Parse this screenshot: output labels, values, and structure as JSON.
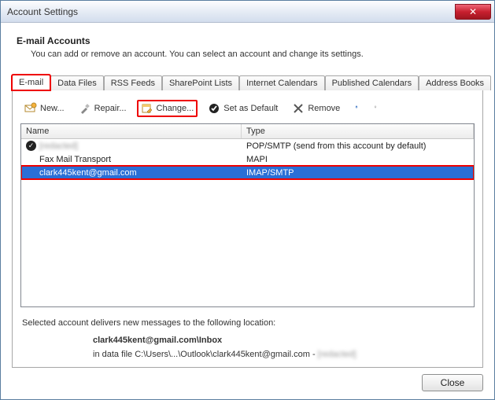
{
  "window": {
    "title": "Account Settings"
  },
  "header": {
    "title": "E-mail Accounts",
    "desc": "You can add or remove an account. You can select an account and change its settings."
  },
  "tabs": {
    "items": [
      {
        "label": "E-mail"
      },
      {
        "label": "Data Files"
      },
      {
        "label": "RSS Feeds"
      },
      {
        "label": "SharePoint Lists"
      },
      {
        "label": "Internet Calendars"
      },
      {
        "label": "Published Calendars"
      },
      {
        "label": "Address Books"
      }
    ]
  },
  "toolbar": {
    "new": "New...",
    "repair": "Repair...",
    "change": "Change...",
    "default": "Set as Default",
    "remove": "Remove"
  },
  "list": {
    "columns": {
      "name": "Name",
      "type": "Type"
    },
    "rows": [
      {
        "name": "[redacted]",
        "type": "POP/SMTP (send from this account by default)",
        "default": true,
        "blurred": true
      },
      {
        "name": "Fax Mail Transport",
        "type": "MAPI"
      },
      {
        "name": "clark445kent@gmail.com",
        "type": "IMAP/SMTP",
        "selected": true
      }
    ]
  },
  "footer": {
    "lead": "Selected account delivers new messages to the following location:",
    "loc_bold": "clark445kent@gmail.com\\Inbox",
    "loc_path_prefix": "in data file C:\\Users\\...\\Outlook\\clark445kent@gmail.com - ",
    "loc_path_blur": "[redacted]"
  },
  "buttons": {
    "close": "Close"
  }
}
